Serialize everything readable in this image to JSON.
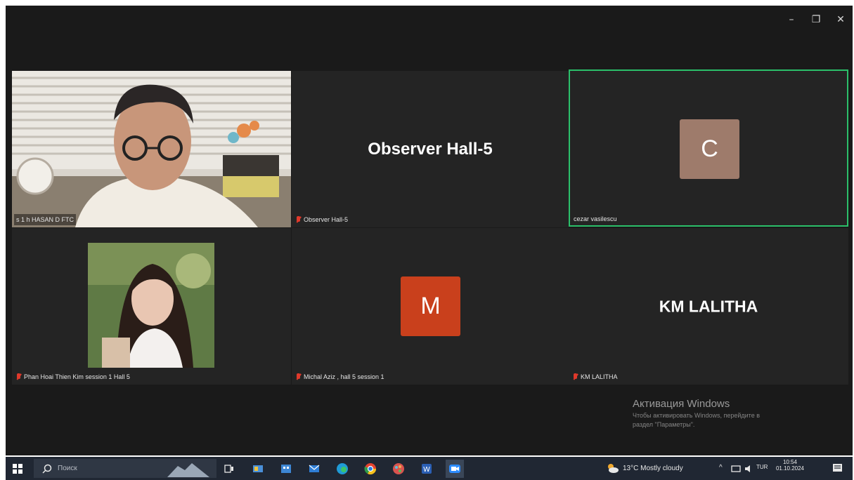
{
  "window_controls": {
    "minimize": "–",
    "maximize": "❐",
    "close": "✕"
  },
  "tiles": [
    {
      "label": "s 1 h HASAN D FTC"
    },
    {
      "center_name": "Observer Hall-5",
      "label": "Observer Hall-5"
    },
    {
      "avatar_letter": "C",
      "label": "cezar vasilescu"
    },
    {
      "label": "Phan Hoai Thien Kim session 1 Hall 5"
    },
    {
      "avatar_letter": "M",
      "label": "Michal Aziz , hall 5 session 1"
    },
    {
      "center_name": "KM LALITHA",
      "label": "KM LALITHA"
    }
  ],
  "watermark": {
    "title": "Активация Windows",
    "line1": "Чтобы активировать Windows, перейдите в",
    "line2": "раздел \"Параметры\"."
  },
  "taskbar": {
    "search_placeholder": "Поиск",
    "weather": "13°C  Mostly cloudy",
    "lang": "TUR",
    "time": "10:54",
    "date": "01.10.2024"
  },
  "colors": {
    "active_speaker_border": "#2bbf6a",
    "avatar_c": "#9e7b6b",
    "avatar_m": "#c9401c"
  }
}
